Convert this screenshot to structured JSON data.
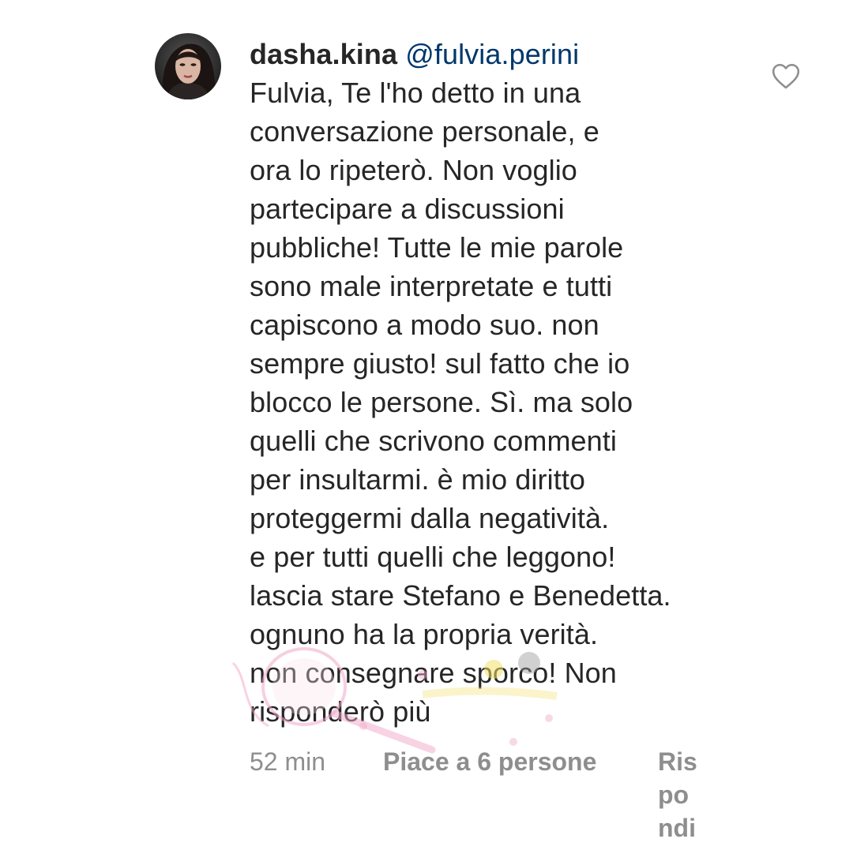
{
  "comment": {
    "username": "dasha.kina",
    "mention": "@fulvia.perini",
    "lines": [
      "Fulvia, Te l'ho detto in una",
      "conversazione personale, e",
      "ora lo ripeterò. Non voglio",
      "partecipare a discussioni",
      "pubbliche! Tutte le mie parole",
      "sono male interpretate e tutti",
      "capiscono a modo suo. non",
      "sempre giusto! sul fatto che io",
      "blocco le persone. Sì. ma solo",
      "quelli che scrivono commenti",
      "per insultarmi. è mio diritto",
      "proteggermi dalla negatività.",
      "e per tutti quelli che leggono!",
      "lascia stare Stefano e Benedetta.",
      "ognuno ha la propria verità.",
      "non consegnare sporco! Non",
      "risponderò più"
    ],
    "time": "52 min",
    "likes": "Piace a 6 persone",
    "reply_parts": [
      "Ris",
      "po",
      "ndi"
    ]
  },
  "icons": {
    "like": "heart-outline-icon",
    "avatar": "user-avatar"
  },
  "colors": {
    "text": "#262626",
    "mention": "#00376b",
    "meta": "#8e8e8e",
    "heart": "#8e8e8e"
  }
}
